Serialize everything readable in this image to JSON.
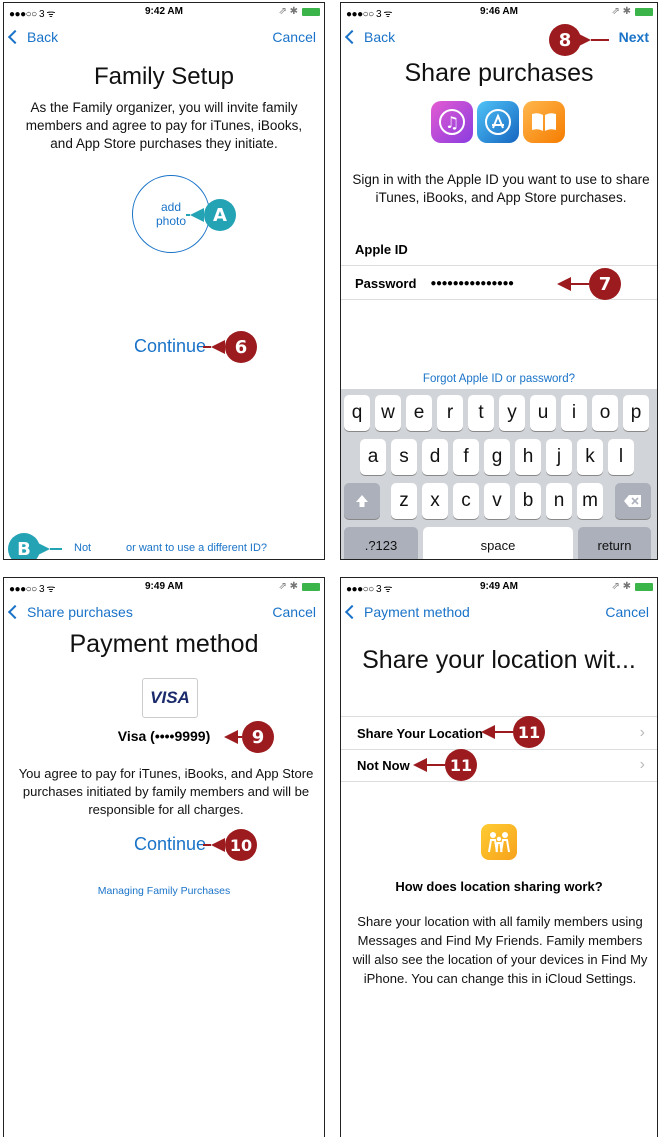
{
  "panel1": {
    "status": {
      "left": "●●●○○ 3 ᯤ",
      "time": "9:42 AM",
      "right": "⇗ ✱"
    },
    "back": "Back",
    "cancel": "Cancel",
    "title": "Family Setup",
    "description": "As the Family organizer, you will invite family members and agree to pay for iTunes, iBooks, and App Store purchases they initiate.",
    "add_photo": "add photo",
    "callout_a": "A",
    "continue": "Continue",
    "callout_6": "6",
    "callout_b": "B",
    "footer_not": "Not",
    "footer_rest": "or want to use a different ID?"
  },
  "panel2": {
    "status": {
      "left": "●●●○○ 3 ᯤ",
      "time": "9:46 AM",
      "right": "⇗ ✱"
    },
    "back": "Back",
    "next": "Next",
    "callout_8": "8",
    "title": "Share purchases",
    "description": "Sign in with the Apple ID you want to use to share iTunes, iBooks, and App Store purchases.",
    "apple_id_label": "Apple ID",
    "password_label": "Password",
    "password_value": "●●●●●●●●●●●●●●●",
    "callout_7": "7",
    "forgot": "Forgot Apple ID or password?",
    "keys_row1": [
      "q",
      "w",
      "e",
      "r",
      "t",
      "y",
      "u",
      "i",
      "o",
      "p"
    ],
    "keys_row2": [
      "a",
      "s",
      "d",
      "f",
      "g",
      "h",
      "j",
      "k",
      "l"
    ],
    "keys_row3": [
      "z",
      "x",
      "c",
      "v",
      "b",
      "n",
      "m"
    ],
    "key_123": ".?123",
    "key_space": "space",
    "key_return": "return"
  },
  "panel3": {
    "status": {
      "left": "●●●○○ 3 ᯤ",
      "time": "9:49 AM",
      "right": "⇗ ✱"
    },
    "back": "Share purchases",
    "cancel": "Cancel",
    "title": "Payment method",
    "visa_logo": "VISA",
    "card": "Visa (••••9999)",
    "callout_9": "9",
    "description": "You agree to pay for iTunes, iBooks, and App Store purchases initiated by family members and will be responsible for all charges.",
    "continue": "Continue",
    "callout_10": "10",
    "managing": "Managing Family Purchases"
  },
  "panel4": {
    "status": {
      "left": "●●●○○ 3 ᯤ",
      "time": "9:49 AM",
      "right": "⇗ ✱"
    },
    "back": "Payment method",
    "cancel": "Cancel",
    "title": "Share your location wit...",
    "share_location": "Share Your Location",
    "not_now": "Not Now",
    "callout_11a": "11",
    "callout_11b": "11",
    "how_title": "How does location sharing work?",
    "description": "Share your location with all family members using Messages and Find My Friends. Family members will also see the location of your devices in Find My iPhone. You can change this in iCloud Settings."
  },
  "colors": {
    "accent": "#1a73c8",
    "callout_red": "#9c1b1f",
    "callout_teal": "#24a3b5",
    "battery": "#3bb44a"
  }
}
